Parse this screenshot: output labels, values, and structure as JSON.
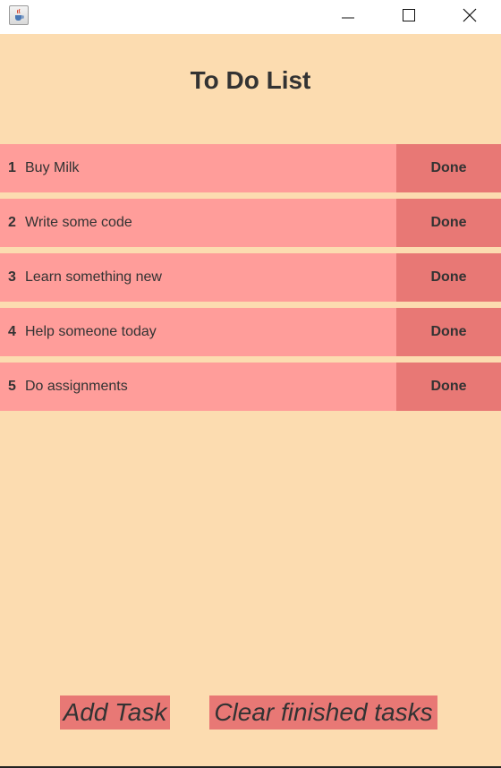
{
  "window": {
    "icons": [
      "java-cup-icon",
      "minimize-icon",
      "maximize-icon",
      "close-icon"
    ]
  },
  "app": {
    "title": "To Do List",
    "tasks": [
      {
        "number": "1",
        "text": "Buy Milk",
        "done_label": "Done"
      },
      {
        "number": "2",
        "text": "Write some code",
        "done_label": "Done"
      },
      {
        "number": "3",
        "text": "Learn something new",
        "done_label": "Done"
      },
      {
        "number": "4",
        "text": "Help someone today",
        "done_label": "Done"
      },
      {
        "number": "5",
        "text": "Do assignments",
        "done_label": "Done"
      }
    ],
    "footer": {
      "add_label": "Add Task",
      "clear_label": "Clear finished tasks"
    }
  },
  "colors": {
    "background": "#fcdcb0",
    "task_bg": "#ff9d9a",
    "button_bg": "#e87875",
    "text": "#333333"
  }
}
